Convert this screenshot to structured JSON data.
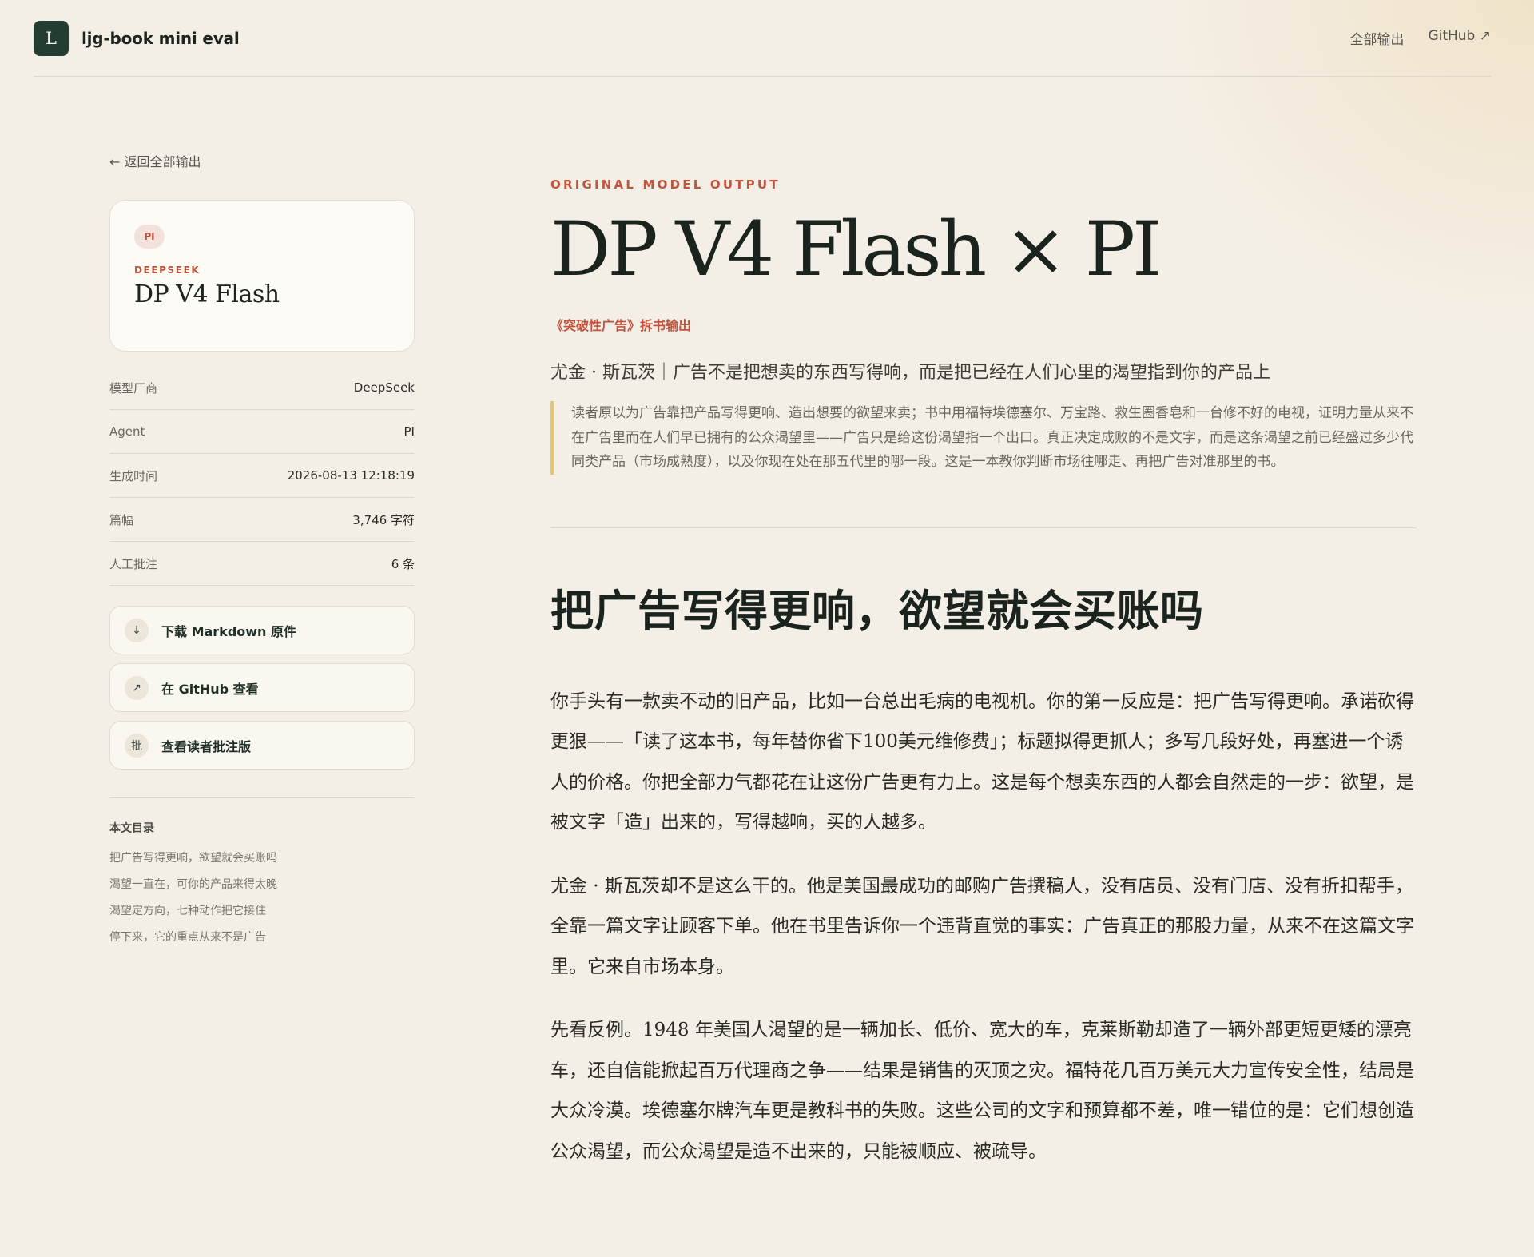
{
  "header": {
    "logo_letter": "L",
    "brand_name": "ljg-book mini eval",
    "nav": [
      {
        "label": "全部输出"
      },
      {
        "label": "GitHub ↗"
      }
    ]
  },
  "sidebar": {
    "back_link": "← 返回全部输出",
    "card": {
      "agent_badge": "PI",
      "vendor": "DEEPSEEK",
      "model_name": "DP V4 Flash"
    },
    "meta": [
      {
        "key": "模型厂商",
        "value": "DeepSeek"
      },
      {
        "key": "Agent",
        "value": "PI"
      },
      {
        "key": "生成时间",
        "value": "2026-08-13 12:18:19"
      },
      {
        "key": "篇幅",
        "value": "3,746 字符"
      },
      {
        "key": "人工批注",
        "value": "6 条"
      }
    ],
    "actions": [
      {
        "icon": "↓",
        "label": "下载 Markdown 原件"
      },
      {
        "icon": "↗",
        "label": "在 GitHub 查看"
      },
      {
        "icon": "批",
        "label": "查看读者批注版"
      }
    ],
    "toc": {
      "title": "本文目录",
      "items": [
        "把广告写得更响，欲望就会买账吗",
        "渴望一直在，可你的产品来得太晚",
        "渴望定方向，七种动作把它接住",
        "停下来，它的重点从来不是广告"
      ]
    }
  },
  "main": {
    "eyebrow": "ORIGINAL MODEL OUTPUT",
    "title": "DP V4 Flash × PI",
    "subtitle": "《突破性广告》拆书输出",
    "lead": "尤金 · 斯瓦茨｜广告不是把想卖的东西写得响，而是把已经在人们心里的渴望指到你的产品上",
    "quote": "读者原以为广告靠把产品写得更响、造出想要的欲望来卖；书中用福特埃德塞尔、万宝路、救生圈香皂和一台修不好的电视，证明力量从来不在广告里而在人们早已拥有的公众渴望里——广告只是给这份渴望指一个出口。真正决定成败的不是文字，而是这条渴望之前已经盛过多少代同类产品（市场成熟度），以及你现在处在那五代里的哪一段。这是一本教你判断市场往哪走、再把广告对准那里的书。",
    "section_heading": "把广告写得更响，欲望就会买账吗",
    "paragraphs": [
      "你手头有一款卖不动的旧产品，比如一台总出毛病的电视机。你的第一反应是：把广告写得更响。承诺砍得更狠——「读了这本书，每年替你省下100美元维修费」；标题拟得更抓人；多写几段好处，再塞进一个诱人的价格。你把全部力气都花在让这份广告更有力上。这是每个想卖东西的人都会自然走的一步：欲望，是被文字「造」出来的，写得越响，买的人越多。",
      "尤金 · 斯瓦茨却不是这么干的。他是美国最成功的邮购广告撰稿人，没有店员、没有门店、没有折扣帮手，全靠一篇文字让顾客下单。他在书里告诉你一个违背直觉的事实：广告真正的那股力量，从来不在这篇文字里。它来自市场本身。",
      "先看反例。1948 年美国人渴望的是一辆加长、低价、宽大的车，克莱斯勒却造了一辆外部更短更矮的漂亮车，还自信能掀起百万代理商之争——结果是销售的灭顶之灾。福特花几百万美元大力宣传安全性，结局是大众冷漠。埃德塞尔牌汽车更是教科书的失败。这些公司的文字和预算都不差，唯一错位的是：它们想创造公众渴望，而公众渴望是造不出来的，只能被顺应、被疏导。"
    ]
  }
}
